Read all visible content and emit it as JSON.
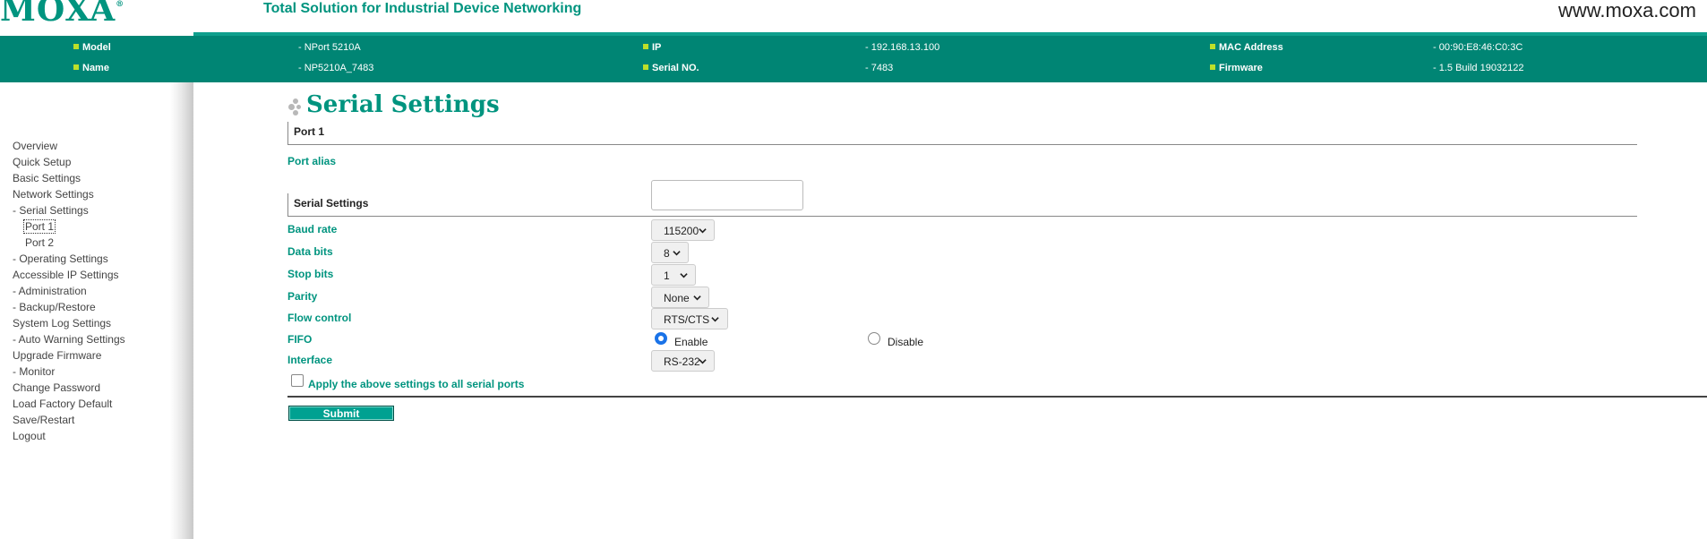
{
  "header": {
    "logo": "MOXA",
    "logo_reg": "®",
    "slogan": "Total Solution for Industrial Device Networking",
    "website": "www.moxa.com"
  },
  "info": {
    "model_label": "Model",
    "model_value": "- NPort 5210A",
    "name_label": "Name",
    "name_value": "- NP5210A_7483",
    "ip_label": "IP",
    "ip_value": "- 192.168.13.100",
    "serial_label": "Serial NO.",
    "serial_value": "- 7483",
    "mac_label": "MAC Address",
    "mac_value": "- 00:90:E8:46:C0:3C",
    "firmware_label": "Firmware",
    "firmware_value": "- 1.5 Build 19032122"
  },
  "sidebar": {
    "items": [
      {
        "label": "Overview"
      },
      {
        "label": "Quick Setup"
      },
      {
        "label": "Basic Settings"
      },
      {
        "label": "Network Settings"
      },
      {
        "label": "- Serial Settings"
      },
      {
        "label": "Port 1"
      },
      {
        "label": "Port 2"
      },
      {
        "label": "- Operating Settings"
      },
      {
        "label": "Accessible IP Settings"
      },
      {
        "label": "- Administration"
      },
      {
        "label": "- Backup/Restore"
      },
      {
        "label": "System Log Settings"
      },
      {
        "label": "- Auto Warning Settings"
      },
      {
        "label": "Upgrade Firmware"
      },
      {
        "label": "- Monitor"
      },
      {
        "label": "Change Password"
      },
      {
        "label": "Load Factory Default"
      },
      {
        "label": "Save/Restart"
      },
      {
        "label": "Logout"
      }
    ]
  },
  "main": {
    "title": "Serial Settings",
    "port_section": "Port 1",
    "port_alias_label": "Port alias",
    "port_alias_value": "",
    "serial_section": "Serial Settings",
    "baud_rate_label": "Baud rate",
    "baud_rate_value": "115200",
    "data_bits_label": "Data bits",
    "data_bits_value": "8",
    "stop_bits_label": "Stop bits",
    "stop_bits_value": "1",
    "parity_label": "Parity",
    "parity_value": "None",
    "flow_control_label": "Flow control",
    "flow_control_value": "RTS/CTS",
    "fifo_label": "FIFO",
    "fifo_enable": "Enable",
    "fifo_disable": "Disable",
    "fifo_selected": "Enable",
    "interface_label": "Interface",
    "interface_value": "RS-232",
    "apply_all_label": "Apply the above settings to all serial ports",
    "apply_all_checked": false,
    "submit_label": "Submit"
  },
  "colors": {
    "brand": "#00947f",
    "infobar": "#008574",
    "info_bullet": "#bde02a",
    "submit": "#00a191",
    "radio_selected": "#1a73e8"
  }
}
